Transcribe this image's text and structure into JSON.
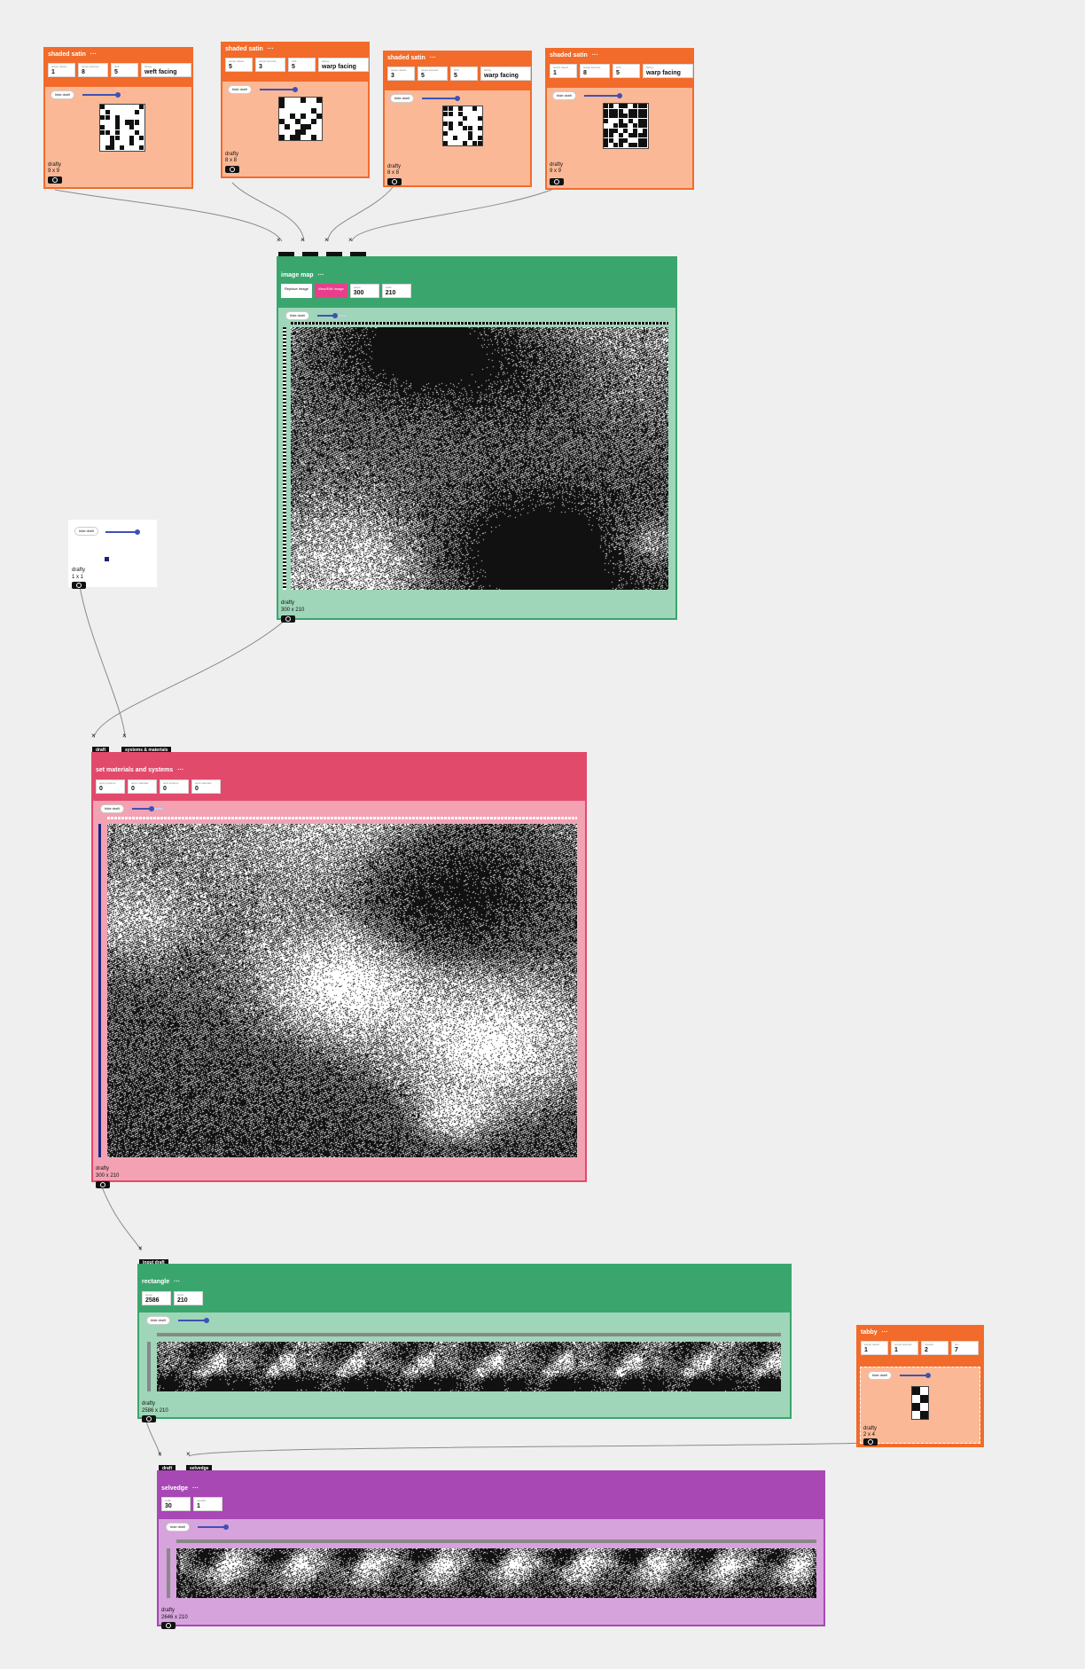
{
  "colors": {
    "orange": "#f26b2a",
    "green": "#3aa66e",
    "pink": "#e24a6b",
    "purple": "#a748b4",
    "background": "#efefef"
  },
  "common": {
    "hide_draft": "hide draft",
    "more": "···",
    "footer_name": "drafty",
    "eye_icon": "eye-icon",
    "close_icon": "×"
  },
  "shaded_satin_1": {
    "title": "shaded satin",
    "params": [
      {
        "label": "warps raised",
        "value": "1"
      },
      {
        "label": "warps lowered",
        "value": "8"
      },
      {
        "label": "shift",
        "value": "5"
      },
      {
        "label": "facing",
        "value": "weft facing"
      }
    ],
    "size": "9 x 9"
  },
  "shaded_satin_2": {
    "title": "shaded satin",
    "params": [
      {
        "label": "warps raised",
        "value": "5"
      },
      {
        "label": "warps lowered",
        "value": "3"
      },
      {
        "label": "shift",
        "value": "5"
      },
      {
        "label": "facing",
        "value": "warp facing"
      }
    ],
    "size": "8 x 8"
  },
  "shaded_satin_3": {
    "title": "shaded satin",
    "params": [
      {
        "label": "warps raised",
        "value": "3"
      },
      {
        "label": "warps lowered",
        "value": "5"
      },
      {
        "label": "shift",
        "value": "5"
      },
      {
        "label": "facing",
        "value": "warp facing"
      }
    ],
    "size": "8 x 8"
  },
  "shaded_satin_4": {
    "title": "shaded satin",
    "params": [
      {
        "label": "warps raised",
        "value": "1"
      },
      {
        "label": "warps lowered",
        "value": "8"
      },
      {
        "label": "shift",
        "value": "5"
      },
      {
        "label": "facing",
        "value": "warp facing"
      }
    ],
    "size": "9 x 9"
  },
  "image_map": {
    "title": "image map",
    "replace_label": "Replace Image",
    "view_edit_label": "View/Edit Image",
    "params": [
      {
        "label": "warps",
        "value": "300"
      },
      {
        "label": "wefts",
        "value": "210"
      }
    ],
    "size": "300 x 210"
  },
  "small_draft": {
    "size": "1 x 1"
  },
  "set_materials": {
    "title": "set materials and systems",
    "ports": [
      "draft",
      "systems & materials"
    ],
    "params": [
      {
        "label": "warp systems",
        "value": "0"
      },
      {
        "label": "warp materials",
        "value": "0"
      },
      {
        "label": "weft systems",
        "value": "0"
      },
      {
        "label": "weft materials",
        "value": "0"
      }
    ],
    "size": "300 x 210"
  },
  "rectangle": {
    "title": "rectangle",
    "port": "input draft",
    "params": [
      {
        "label": "warps",
        "value": "2586"
      },
      {
        "label": "wefts",
        "value": "210"
      }
    ],
    "size": "2586 x 210"
  },
  "tabby": {
    "title": "tabby",
    "params": [
      {
        "label": "warps raised",
        "value": "1"
      },
      {
        "label": "warps lowered",
        "value": "1"
      },
      {
        "label": "repeats",
        "value": "2"
      },
      {
        "label": "dim",
        "value": "7"
      }
    ],
    "size": "2 x 4"
  },
  "selvedge": {
    "title": "selvedge",
    "ports": [
      "draft",
      "selvedge"
    ],
    "params": [
      {
        "label": "width",
        "value": "30"
      },
      {
        "label": "repeats",
        "value": "1"
      }
    ],
    "size": "2646 x 210"
  }
}
